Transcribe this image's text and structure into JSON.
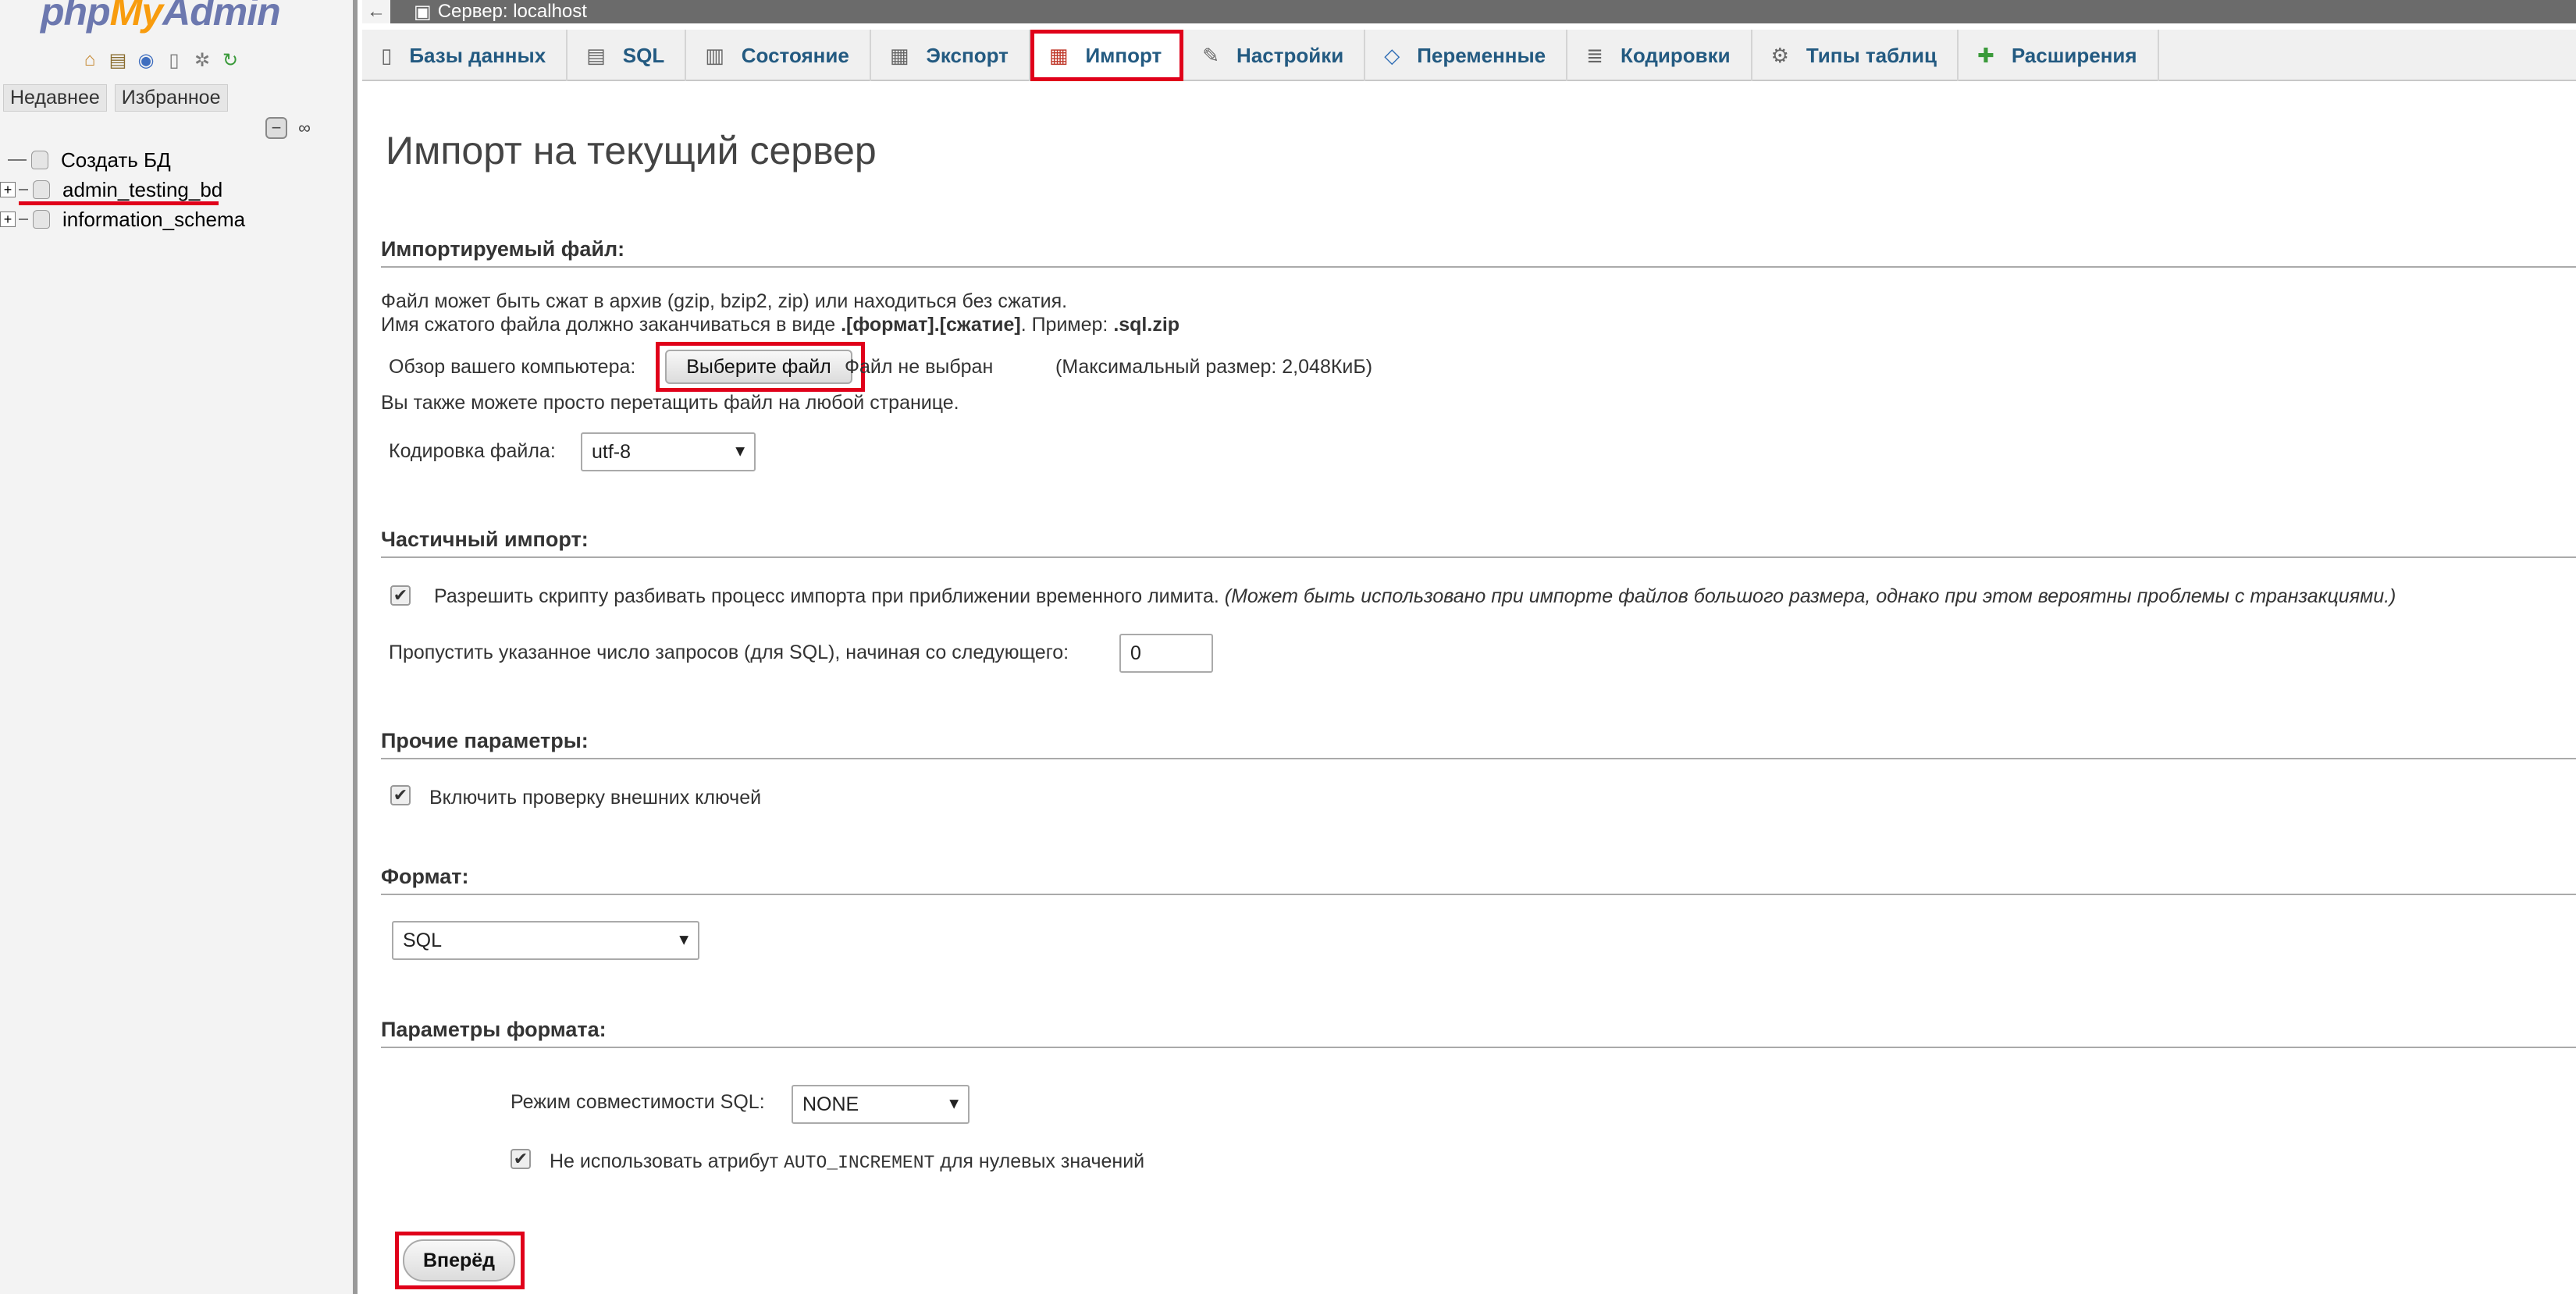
{
  "nav": {
    "logo_php": "php",
    "logo_my": "My",
    "logo_admin": "Admin",
    "icons": [
      "home-icon",
      "logout-icon",
      "help-icon",
      "docs-icon",
      "settings-icon",
      "reload-icon"
    ],
    "recent_tab": "Недавнее",
    "favorites_tab": "Избранное",
    "tree": [
      {
        "label": "Создать БД"
      },
      {
        "label": "admin_testing_bd"
      },
      {
        "label": "information_schema"
      }
    ]
  },
  "serverbar": {
    "back": "←",
    "title": "Сервер: localhost"
  },
  "tabs": [
    {
      "label": "Базы данных",
      "icon": "databases-icon"
    },
    {
      "label": "SQL",
      "icon": "sql-icon"
    },
    {
      "label": "Состояние",
      "icon": "status-icon"
    },
    {
      "label": "Экспорт",
      "icon": "export-icon"
    },
    {
      "label": "Импорт",
      "icon": "import-icon"
    },
    {
      "label": "Настройки",
      "icon": "wrench-icon"
    },
    {
      "label": "Переменные",
      "icon": "variables-icon"
    },
    {
      "label": "Кодировки",
      "icon": "charset-icon"
    },
    {
      "label": "Типы таблиц",
      "icon": "engines-icon"
    },
    {
      "label": "Расширения",
      "icon": "plugins-icon"
    }
  ],
  "active_tab": "Импорт",
  "highlight_color": "#e0001a",
  "page": {
    "title": "Импорт на текущий сервер",
    "file_section": {
      "title": "Импортируемый файл:",
      "line1": "Файл может быть сжат в архив (gzip, bzip2, zip) или находиться без сжатия.",
      "line2_pre": "Имя сжатого файла должно заканчиваться в виде ",
      "line2_bold": ".[формат].[сжатие]",
      "line2_mid": ". Пример: ",
      "line2_example": ".sql.zip",
      "browse_label": "Обзор вашего компьютера:",
      "choose_button": "Выберите файл",
      "no_file": "Файл не выбран",
      "max_size": "(Максимальный размер: 2,048КиБ)",
      "drag_hint": "Вы также можете просто перетащить файл на любой странице.",
      "charset_label": "Кодировка файла:",
      "charset_value": "utf-8"
    },
    "partial_section": {
      "title": "Частичный импорт:",
      "allow_interrupt": "Разрешить скрипту разбивать процесс импорта при приближении временного лимита.",
      "allow_interrupt_note": "(Может быть использовано при импорте файлов большого размера, однако при этом вероятны проблемы с транзакциями.)",
      "allow_interrupt_checked": true,
      "skip_label": "Пропустить указанное число запросов (для SQL), начиная со следующего:",
      "skip_value": "0"
    },
    "other_section": {
      "title": "Прочие параметры:",
      "fk_checks": "Включить проверку внешних ключей",
      "fk_checks_checked": true
    },
    "format_section": {
      "title": "Формат:",
      "format_value": "SQL"
    },
    "format_options_section": {
      "title": "Параметры формата:",
      "compat_label": "Режим совместимости SQL:",
      "compat_value": "NONE",
      "no_auto_pre": "Не использовать атрибут ",
      "no_auto_code": "AUTO_INCREMENT",
      "no_auto_post": " для нулевых значений",
      "no_auto_checked": true
    },
    "go_button": "Вперёд"
  }
}
